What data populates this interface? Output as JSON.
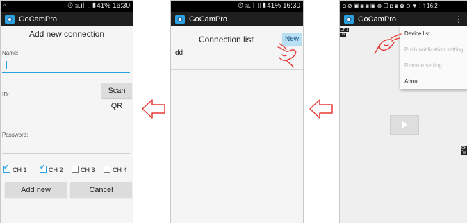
{
  "panel1": {
    "status_right": "⏱ ≋.ıl ▯▮41% 16:30",
    "status_left": "▫",
    "app_title": "GoCamPro",
    "heading": "Add new connection",
    "name_label": "Name:",
    "id_label": "ID:",
    "scan_qr": "Scan QR",
    "password_label": "Password:",
    "channels": [
      {
        "label": "CH 1",
        "checked": true
      },
      {
        "label": "CH 2",
        "checked": true
      },
      {
        "label": "CH 3",
        "checked": false
      },
      {
        "label": "CH 4",
        "checked": false
      }
    ],
    "add_new": "Add new",
    "cancel": "Cancel"
  },
  "panel2": {
    "status_right": "⏱ ≋.ıl ▯▮41% 16:30",
    "app_title": "GoCamPro",
    "heading": "Connection list",
    "new_button": "New",
    "items": [
      "dd"
    ]
  },
  "panel3": {
    "status_left": "◘ ⊘ ▣ ◙ ◙ ▣ ⊗ ☐ ◘ ◙ ✿ ⊖ ▼ ⁞ ▯ 16:2",
    "app_title": "GoCamPro",
    "overflow_icon": "⋮",
    "ch_tag_1": "CH 1",
    "ch_tag_2": "0/s",
    "ch_tag_3": "CH 1",
    "ch_tag_4": "0/",
    "menu": [
      {
        "label": "Device list",
        "enabled": true
      },
      {
        "label": "Push notification setting",
        "enabled": false
      },
      {
        "label": "Remote setting",
        "enabled": false
      },
      {
        "label": "About",
        "enabled": true
      }
    ]
  },
  "colors": {
    "accent": "#2aa3e0",
    "bar": "#1f1f1f",
    "arrow": "#e53935"
  }
}
